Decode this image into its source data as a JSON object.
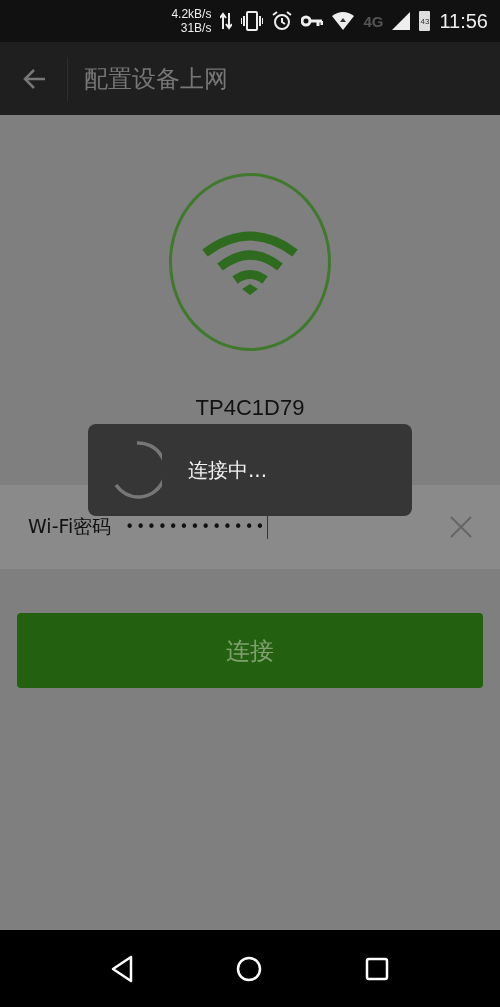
{
  "status_bar": {
    "speed_top": "4.2kB/s",
    "speed_bottom": "31B/s",
    "network": "4G",
    "battery": "43",
    "time": "11:56"
  },
  "header": {
    "title": "配置设备上网"
  },
  "device": {
    "ssid": "TP4C1D79"
  },
  "password": {
    "label": "Wi-Fi密码",
    "value": "•••••••••••••"
  },
  "connect_button": {
    "label": "连接"
  },
  "dialog": {
    "message": "连接中..."
  }
}
